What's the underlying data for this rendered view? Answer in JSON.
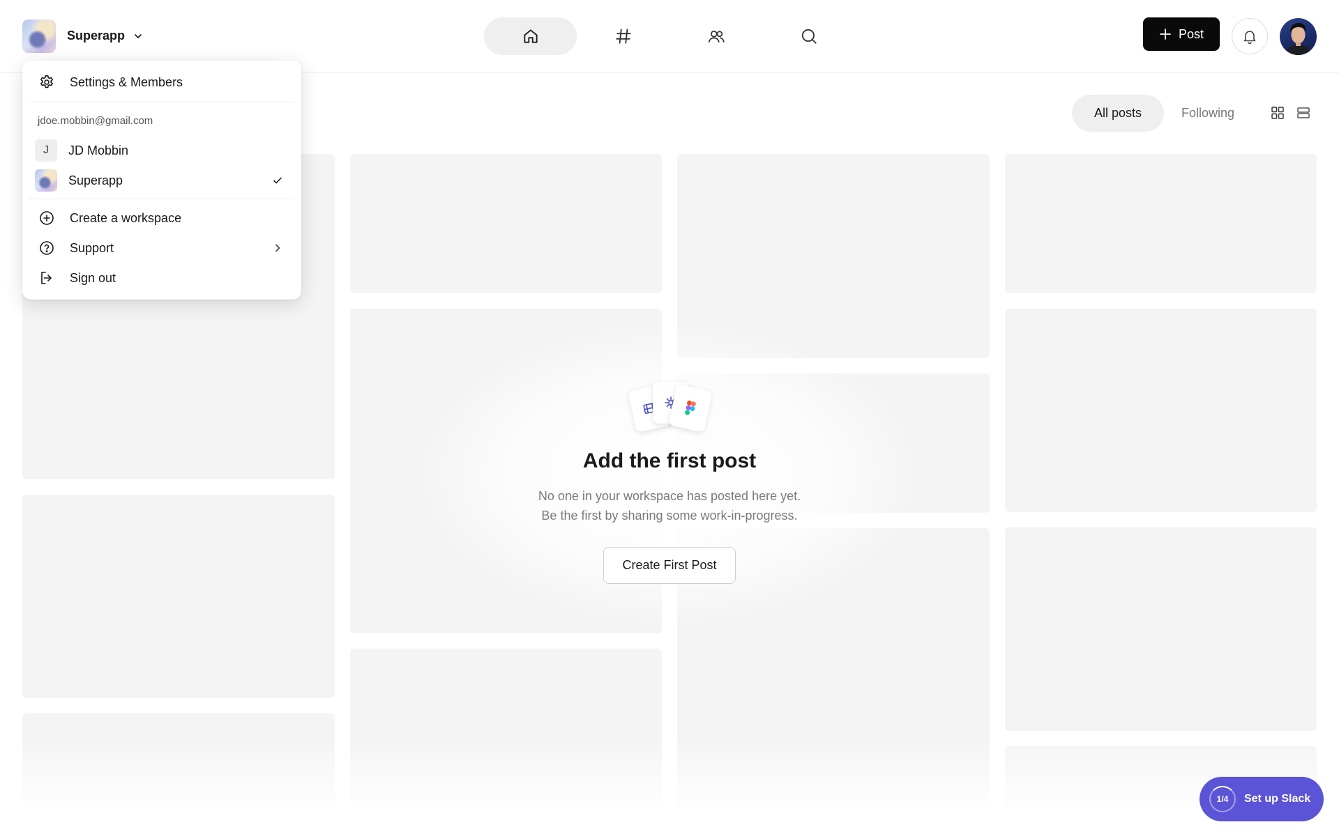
{
  "header": {
    "workspace_name": "Superapp",
    "post_label": "Post",
    "nav": [
      "home",
      "channels",
      "people",
      "search"
    ]
  },
  "filters": {
    "all_posts": "All posts",
    "following": "Following"
  },
  "empty_state": {
    "title": "Add the first post",
    "line1": "No one in your workspace has posted here yet.",
    "line2": "Be the first by sharing some work-in-progress.",
    "button": "Create First Post"
  },
  "menu": {
    "settings": "Settings & Members",
    "email": "jdoe.mobbin@gmail.com",
    "account_initial": "J",
    "account_name": "JD Mobbin",
    "workspace": "Superapp",
    "create_workspace": "Create a workspace",
    "support": "Support",
    "sign_out": "Sign out"
  },
  "onboarding": {
    "progress": "1/4",
    "label": "Set up Slack"
  },
  "colors": {
    "accent": "#5b54d6",
    "primary_button": "#0a0a0a",
    "skeleton": "#f4f4f4"
  }
}
